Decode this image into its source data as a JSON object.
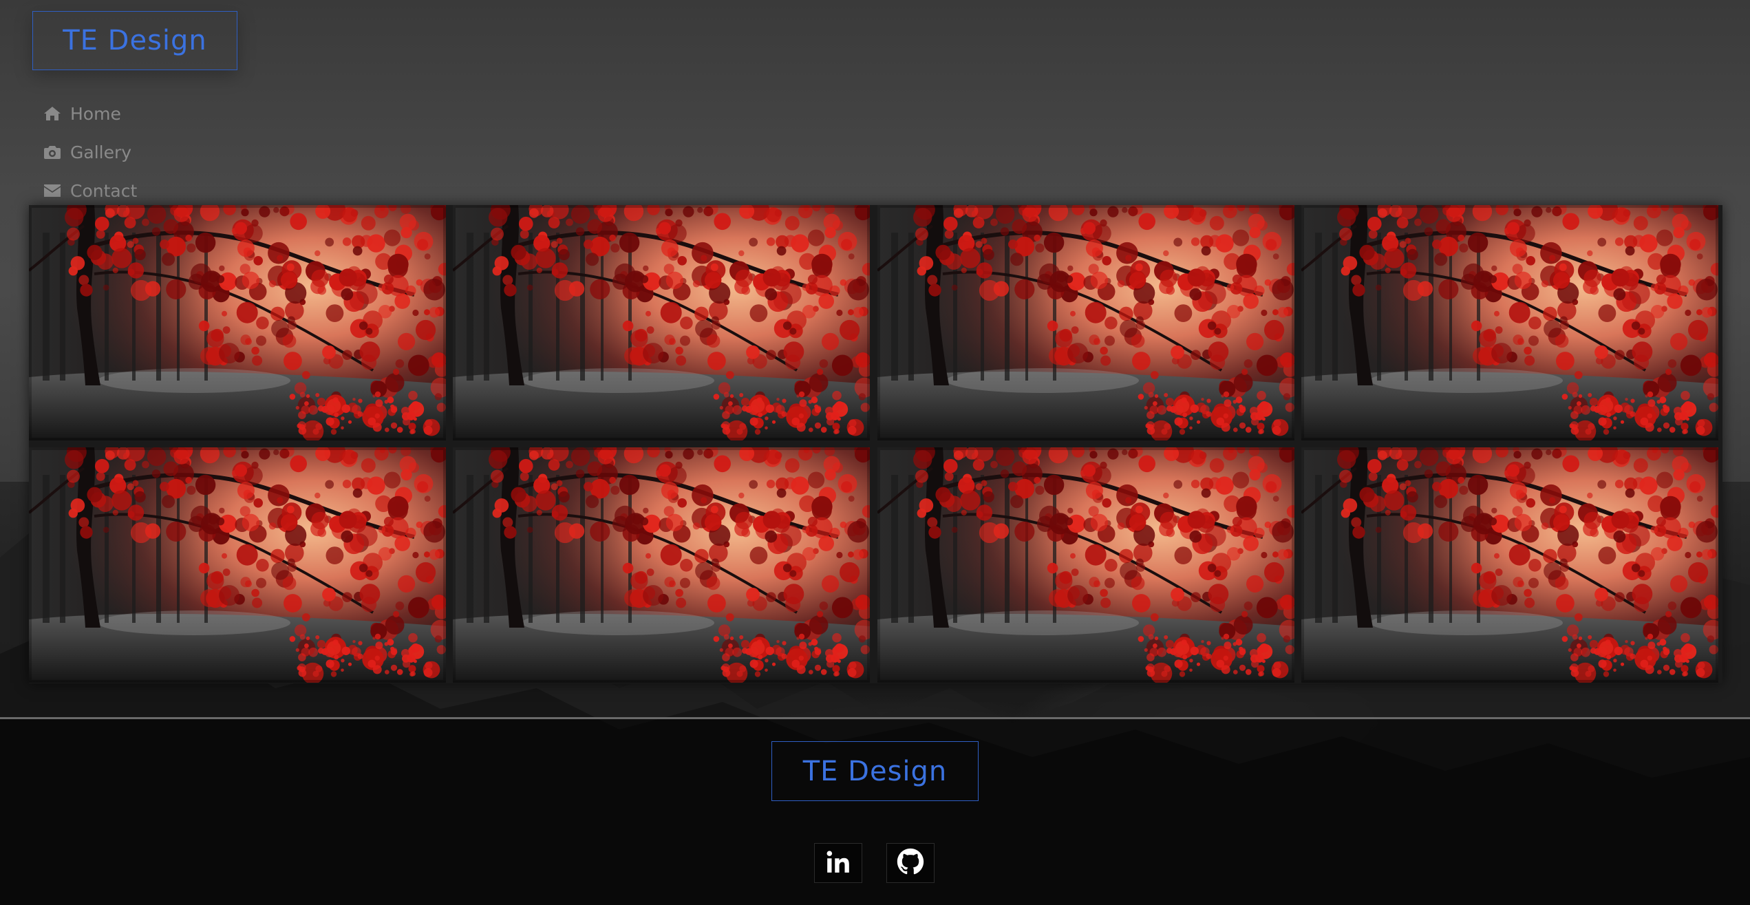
{
  "brand": {
    "title": "TE Design"
  },
  "nav": {
    "items": [
      {
        "label": "Home",
        "icon": "home-icon"
      },
      {
        "label": "Gallery",
        "icon": "camera-icon"
      },
      {
        "label": "Contact",
        "icon": "envelope-icon"
      }
    ]
  },
  "gallery": {
    "image_subject": "red autumn tree in misty forest",
    "tile_count": 8
  },
  "footer": {
    "brand": "TE Design",
    "social": [
      {
        "name": "linkedin",
        "icon": "linkedin-icon"
      },
      {
        "name": "github",
        "icon": "github-icon"
      }
    ]
  },
  "colors": {
    "accent": "#3b72e0",
    "nav_text": "#8a8a8a",
    "background": "#444444",
    "footer": "#0a0a0a"
  }
}
